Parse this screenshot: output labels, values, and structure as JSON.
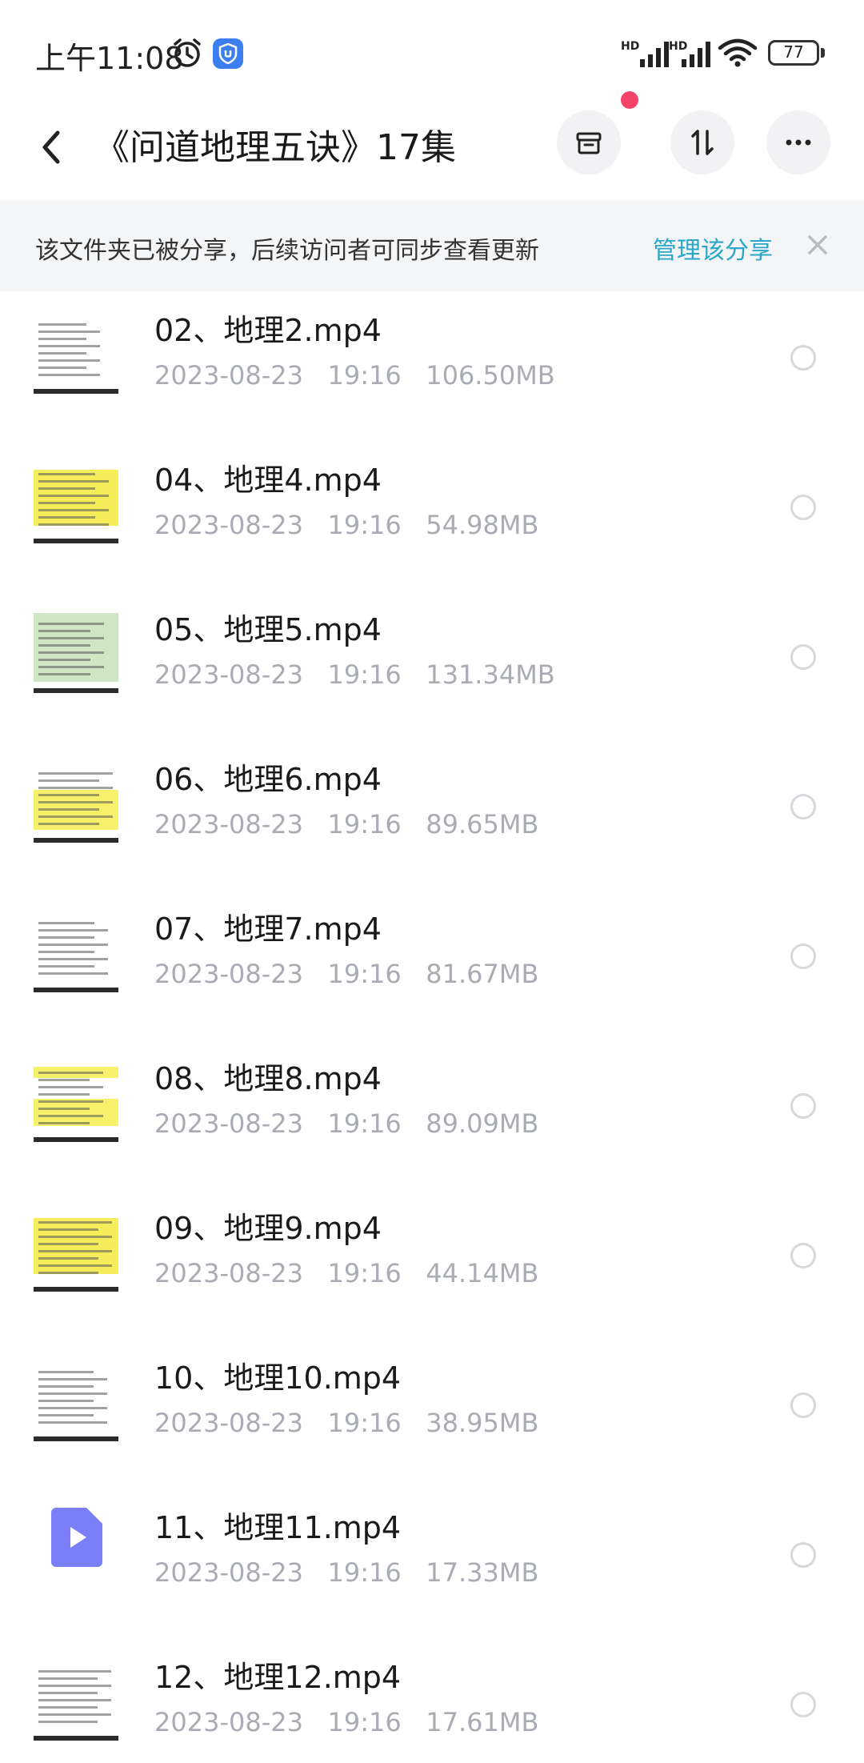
{
  "status_bar": {
    "time": "上午11:08",
    "battery": "77",
    "network_label_1": "HD",
    "network_label_2": "HD"
  },
  "header": {
    "title": "《问道地理五诀》17集"
  },
  "banner": {
    "text": "该文件夹已被分享，后续访问者可同步查看更新",
    "link": "管理该分享"
  },
  "colors": {
    "accent": "#2aa7c9",
    "badge_red": "#f4436a",
    "video_icon": "#7b7ff7"
  },
  "files": [
    {
      "name": "02、地理2.mp4",
      "meta": "2023-08-23   19:16   106.50MB",
      "thumb": "white"
    },
    {
      "name": "04、地理4.mp4",
      "meta": "2023-08-23   19:16   54.98MB",
      "thumb": "yellow"
    },
    {
      "name": "05、地理5.mp4",
      "meta": "2023-08-23   19:16   131.34MB",
      "thumb": "green"
    },
    {
      "name": "06、地理6.mp4",
      "meta": "2023-08-23   19:16   89.65MB",
      "thumb": "yellow-bottom"
    },
    {
      "name": "07、地理7.mp4",
      "meta": "2023-08-23   19:16   81.67MB",
      "thumb": "white"
    },
    {
      "name": "08、地理8.mp4",
      "meta": "2023-08-23   19:16   89.09MB",
      "thumb": "yellow-bands"
    },
    {
      "name": "09、地理9.mp4",
      "meta": "2023-08-23   19:16   44.14MB",
      "thumb": "yellow"
    },
    {
      "name": "10、地理10.mp4",
      "meta": "2023-08-23   19:16   38.95MB",
      "thumb": "white"
    },
    {
      "name": "11、地理11.mp4",
      "meta": "2023-08-23   19:16   17.33MB",
      "thumb": "video-icon"
    },
    {
      "name": "12、地理12.mp4",
      "meta": "2023-08-23   19:16   17.61MB",
      "thumb": "white"
    }
  ]
}
